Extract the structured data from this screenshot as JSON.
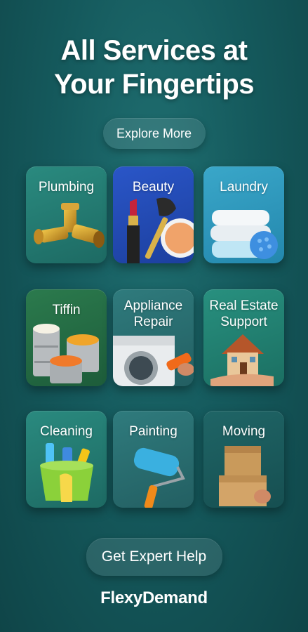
{
  "headline": {
    "line1": "All Services at",
    "line2": "Your Fingertips"
  },
  "explore_button": "Explore More",
  "services": [
    {
      "label": "Plumbing",
      "icon": "pipe-fitting-icon"
    },
    {
      "label": "Beauty",
      "icon": "makeup-icon"
    },
    {
      "label": "Laundry",
      "icon": "towels-icon"
    },
    {
      "label": "Tiffin",
      "icon": "tiffin-box-icon"
    },
    {
      "label": "Appliance",
      "label2": "Repair",
      "icon": "washing-machine-icon"
    },
    {
      "label": "Real Estate",
      "label2": "Support",
      "icon": "house-in-hand-icon"
    },
    {
      "label": "Cleaning",
      "icon": "cleaning-bucket-icon"
    },
    {
      "label": "Painting",
      "icon": "paint-roller-icon"
    },
    {
      "label": "Moving",
      "icon": "boxes-icon"
    }
  ],
  "cta_button": "Get Expert Help",
  "brand": "FlexyDemand",
  "colors": {
    "background": "#155a5d",
    "beauty_tile": "#2a56c8",
    "laundry_tile": "#3aa7c9"
  }
}
